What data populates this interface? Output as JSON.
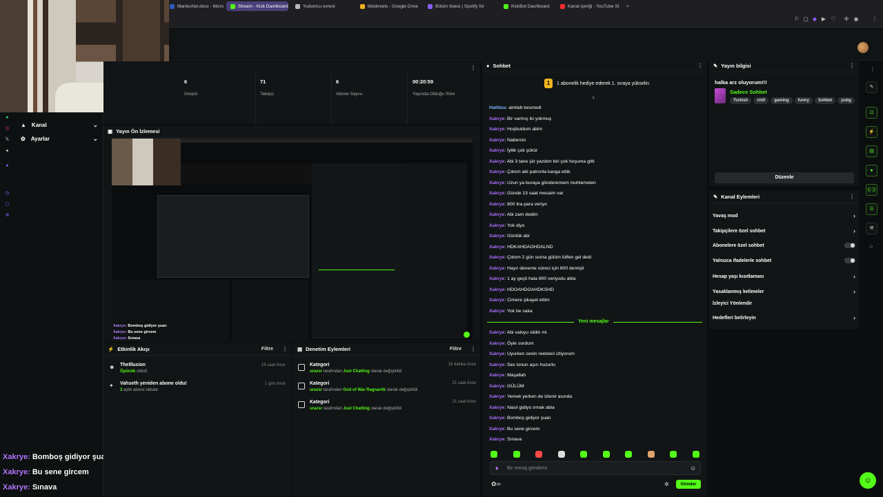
{
  "browser": {
    "tabs": [
      {
        "label": "Mankurtlar.docx - Micro",
        "color": "#2b5cb8"
      },
      {
        "label": "Stream - Kick Dashboard",
        "color": "#53fc18",
        "active": true
      },
      {
        "label": "Yudumcu evreni",
        "color": "#bbbbbb"
      },
      {
        "label": "tiktokreels - Google Drive",
        "color": "#f2b21b"
      },
      {
        "label": "Bölüm listesi | Spotify for",
        "color": "#8d5cff"
      },
      {
        "label": "KickBot Dashboard",
        "color": "#53fc18"
      },
      {
        "label": "Kanal içeriği - YouTube St",
        "color": "#ff2d2d"
      }
    ],
    "new_tab": "+"
  },
  "sidebar": {
    "items": [
      {
        "label": "Kanal",
        "icon": "broadcast-icon"
      },
      {
        "label": "Ayarlar",
        "icon": "gear-icon"
      }
    ]
  },
  "stats": [
    {
      "value": "6",
      "label": "İzleyici"
    },
    {
      "value": "71",
      "label": "Takipçi"
    },
    {
      "value": "6",
      "label": "Abone Sayısı"
    },
    {
      "value": "00:20:59",
      "label": "Yayında Olduğu Süre"
    }
  ],
  "preview": {
    "title": "Yayın Ön İzlemesi"
  },
  "activity": {
    "title": "Etkinlik Akışı",
    "filter": "Filtre",
    "items": [
      {
        "title": "TheIllusion",
        "sub": "Öpücük",
        "sub_rest": " silindi",
        "time": "19 saat önce"
      },
      {
        "title": "Vahseth yeniden abone oldu!",
        "sub": "3",
        "sub_rest": " aylık abone oldular",
        "time": "1 gün önce"
      }
    ]
  },
  "moderation": {
    "title": "Denetim Eylemleri",
    "filter": "Filtre",
    "items": [
      {
        "title": "Kategori",
        "user": "urazsr",
        "mid": " tarafından ",
        "game": "Just Chatting",
        "end": " olarak değiştirildi",
        "time": "19 dakika önce"
      },
      {
        "title": "Kategori",
        "user": "urazsr",
        "mid": " tarafından ",
        "game": "God of War Ragnarök",
        "end": " olarak değiştirildi",
        "time": "21 saat önce"
      },
      {
        "title": "Kategori",
        "user": "urazsr",
        "mid": " tarafından ",
        "game": "Just Chatting",
        "end": " olarak değiştirildi",
        "time": "21 saat önce"
      }
    ]
  },
  "chat": {
    "title": "Sohbet",
    "gift_badge": "1",
    "gift_text": "1 abonelik hediye ederek 1. sıraya yükselin",
    "messages": [
      {
        "user": "Hallitus",
        "text": "aimlab kesmedi",
        "blue": true
      },
      {
        "user": "Xakrye",
        "text": "Bir varmış iki yokmuş"
      },
      {
        "user": "Xakrye",
        "text": "Hoşbuldum abim"
      },
      {
        "user": "Xakrye",
        "text": "Nabersin"
      },
      {
        "user": "Xakrye",
        "text": "İyilik çok şükür"
      },
      {
        "user": "Xakrye",
        "text": "Abi 3 tane şiir yazdım biri çok hoşuma gitti"
      },
      {
        "user": "Xakrye",
        "text": "Çıktım abi patronla kavga ettik"
      },
      {
        "user": "Xakrye",
        "text": "Uzun ya buraya gönderemem muhtemelen"
      },
      {
        "user": "Xakrye",
        "text": "Günde 13 saat mesaim var"
      },
      {
        "user": "Xakrye",
        "text": "800 lira para veriyo"
      },
      {
        "user": "Xakrye",
        "text": "Abi zam dedim"
      },
      {
        "user": "Xakrye",
        "text": "Yok diyo"
      },
      {
        "user": "Xakrye",
        "text": "Günlük abi"
      },
      {
        "user": "Xakrye",
        "text": "HDKAHDAOHDALND"
      },
      {
        "user": "Xakrye",
        "text": "Çıktım 2 gün sonra gülüm lütfen gel dedi"
      },
      {
        "user": "Xakrye",
        "text": "Hayır deneme süreci için 800 demişti"
      },
      {
        "user": "Xakrye",
        "text": "1 ay geçti hala 800 veriyodu abla"
      },
      {
        "user": "Xakrye",
        "text": "HDOAHDOAHDKSHD"
      },
      {
        "user": "Xakrye",
        "text": "Cimere şikayet ettim"
      },
      {
        "user": "Xakrye",
        "text": "Yok be saka"
      }
    ],
    "new_messages_label": "Yeni mesajlar",
    "new_messages": [
      {
        "user": "Xakrye",
        "text": "Abi valoyu sildin mi"
      },
      {
        "user": "Xakrye",
        "text": "Öyle sordum"
      },
      {
        "user": "Xakrye",
        "text": "Uyurken senin reelsleri izliyorum"
      },
      {
        "user": "Xakrye",
        "text": "Ses tonun aşırı huzurlu"
      },
      {
        "user": "Xakrye",
        "text": "Maşallah"
      },
      {
        "user": "Xakrye",
        "text": "GÜLÜM"
      },
      {
        "user": "Xakrye",
        "text": "Yemek yerken de izlenir asında"
      },
      {
        "user": "Xakrye",
        "text": "Nasıl gidiyo ırmak abla"
      },
      {
        "user": "Xakrye",
        "text": "Bomboş gidiyor şuan"
      },
      {
        "user": "Xakrye",
        "text": "Bu sene gircem"
      },
      {
        "user": "Xakrye",
        "text": "Sınava"
      }
    ],
    "input_placeholder": "Bir mesaj gönderin",
    "send_label": "Gönder"
  },
  "stream_info": {
    "title": "Yayın bilgisi",
    "stream_title": "halka arz oluyorum!!!",
    "category": "Sadece Sohbet",
    "tags": [
      "Turkish",
      "chill",
      "gaming",
      "funny",
      "Sohbet",
      "pubg"
    ],
    "edit_label": "Düzenle"
  },
  "channel_actions": {
    "title": "Kanal Eylemleri",
    "items": [
      {
        "label": "Yavaş mod",
        "control": "arrow"
      },
      {
        "label": "Takipçilere özel sohbet",
        "control": "arrow"
      },
      {
        "label": "Abonelere özel sohbet",
        "control": "toggle"
      },
      {
        "label": "Yalnızca ifadelerle sohbet",
        "control": "toggle"
      },
      {
        "label": "Hesap yaşı kısıtlaması",
        "control": "arrow"
      },
      {
        "label": "Yasaklanmış kelimeler",
        "control": "arrow"
      },
      {
        "label": "İzleyici Yönlendir",
        "control": "none"
      },
      {
        "label": "Hedefleri belirleyin",
        "control": "arrow"
      }
    ]
  },
  "overlay_chat": [
    {
      "user": "Xakrye",
      "text": "Bomboş gidiyor şuan"
    },
    {
      "user": "Xakrye",
      "text": "Bu sene gircem"
    },
    {
      "user": "Xakrye",
      "text": "Sınava"
    }
  ],
  "preview_overlay_chat": [
    {
      "user": "Xakrye",
      "text": "Bomboş gidiyor şuan"
    },
    {
      "user": "Xakrye",
      "text": "Bu sene gircem"
    },
    {
      "user": "Xakrye",
      "text": "Sınava"
    }
  ],
  "colors": {
    "accent": "#53fc18",
    "username": "#a970ff",
    "bg": "#0b0e0f",
    "panel": "#121516"
  }
}
